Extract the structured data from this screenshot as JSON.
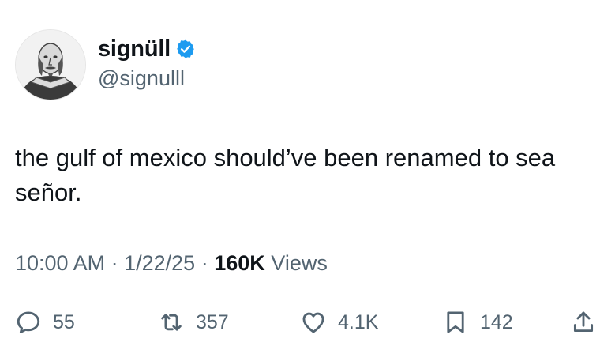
{
  "author": {
    "display_name": "signüll",
    "handle": "@signulll",
    "verified": true,
    "verified_color": "#1d9bf0"
  },
  "tweet": {
    "text": "the gulf of mexico should’ve been renamed to sea señor."
  },
  "meta": {
    "time": "10:00 AM",
    "date": "1/22/25",
    "separator": "·",
    "views_count": "160K",
    "views_label": "Views"
  },
  "actions": {
    "replies": {
      "icon": "reply-icon",
      "count": "55"
    },
    "reposts": {
      "icon": "repost-icon",
      "count": "357"
    },
    "likes": {
      "icon": "heart-icon",
      "count": "4.1K"
    },
    "bookmarks": {
      "icon": "bookmark-icon",
      "count": "142"
    },
    "share": {
      "icon": "share-icon"
    }
  },
  "colors": {
    "text_primary": "#0f1419",
    "text_secondary": "#536471",
    "accent": "#1d9bf0"
  }
}
